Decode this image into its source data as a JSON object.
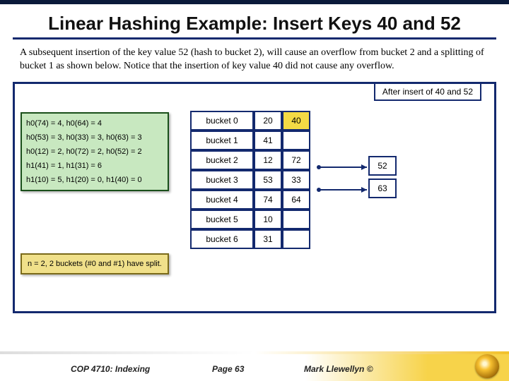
{
  "title": "Linear Hashing Example: Insert Keys 40 and 52",
  "paragraph": "A subsequent insertion of the key value 52 (hash to bucket 2), will cause an overflow from bucket 2 and a splitting of bucket 1 as shown below.   Notice that the insertion of key value 40 did not cause any overflow.",
  "caption": "After insert of 40 and 52",
  "hash_lines": [
    "h0(74) = 4, h0(64) = 4",
    "h0(53) = 3, h0(33) = 3, h0(63) = 3",
    "h0(12) = 2, h0(72) = 2, h0(52) = 2",
    "h1(41) = 1, h1(31) = 6",
    "h1(10) = 5, h1(20) = 0, h1(40) = 0"
  ],
  "n_note": "n = 2, 2 buckets (#0 and #1) have split.",
  "buckets": [
    {
      "label": "bucket 0",
      "cells": [
        "20",
        "40"
      ],
      "new": [
        false,
        true
      ]
    },
    {
      "label": "bucket 1",
      "cells": [
        "41",
        ""
      ],
      "new": [
        false,
        false
      ]
    },
    {
      "label": "bucket 2",
      "cells": [
        "12",
        "72"
      ],
      "new": [
        false,
        false
      ]
    },
    {
      "label": "bucket 3",
      "cells": [
        "53",
        "33"
      ],
      "new": [
        false,
        false
      ]
    },
    {
      "label": "bucket 4",
      "cells": [
        "74",
        "64"
      ],
      "new": [
        false,
        false
      ]
    },
    {
      "label": "bucket 5",
      "cells": [
        "10",
        ""
      ],
      "new": [
        false,
        false
      ]
    },
    {
      "label": "bucket 6",
      "cells": [
        "31",
        ""
      ],
      "new": [
        false,
        false
      ]
    }
  ],
  "overflow": [
    {
      "value": "52",
      "from_row": 2
    },
    {
      "value": "63",
      "from_row": 3
    }
  ],
  "footer": {
    "course": "COP 4710: Indexing",
    "page": "Page 63",
    "author": "Mark Llewellyn ©"
  }
}
